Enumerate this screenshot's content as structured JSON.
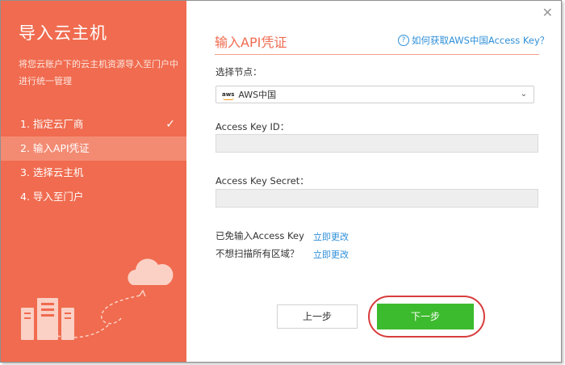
{
  "sidebar": {
    "title": "导入云主机",
    "description": "将您云账户下的云主机资源导入至门户中进行统一管理",
    "steps": [
      {
        "label": "1. 指定云厂商",
        "done": true
      },
      {
        "label": "2. 输入API凭证",
        "active": true
      },
      {
        "label": "3. 选择云主机"
      },
      {
        "label": "4. 导入至门户"
      }
    ],
    "check_glyph": "✓"
  },
  "main": {
    "title": "输入API凭证",
    "help_link": "如何获取AWS中国Access Key？",
    "help_icon_glyph": "?",
    "close_glyph": "✕",
    "region_label": "选择节点：",
    "region_logo": "aws",
    "region_value": "AWS中国",
    "access_key_id_label": "Access Key ID：",
    "access_key_id_value": "",
    "access_key_secret_label": "Access Key Secret：",
    "access_key_secret_value": "",
    "skip_key_text": "已免输入Access Key",
    "skip_key_link": "立即更改",
    "skip_region_text": "不想扫描所有区域？",
    "skip_region_link": "立即更改",
    "prev_button": "上一步",
    "next_button": "下一步"
  },
  "colors": {
    "sidebar_bg": "#f06b4f",
    "accent": "#f06b4f",
    "link": "#2f8fd8",
    "primary_button": "#3dbb2e",
    "highlight_ring": "#d83c3c"
  },
  "icons": [
    "check-icon",
    "help-icon",
    "close-icon",
    "aws-logo-icon",
    "chevron-down-icon",
    "cloud-icon",
    "server-icon"
  ]
}
